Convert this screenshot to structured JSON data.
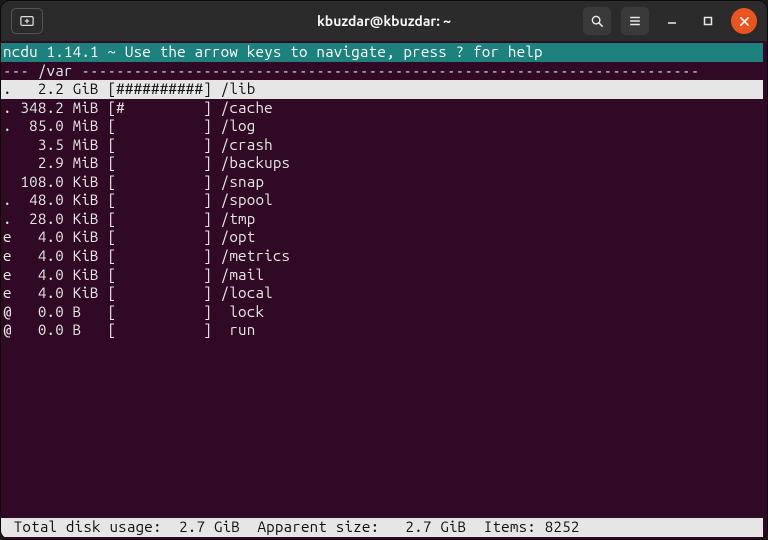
{
  "titlebar": {
    "title": "kbuzdar@kbuzdar: ~"
  },
  "header": "ncdu 1.14.1 ~ Use the arrow keys to navigate, press ? for help",
  "path_prefix": "--- ",
  "path": "/var",
  "bar_full": 10,
  "entries": [
    {
      "flag": ".",
      "size": "2.2",
      "unit": "GiB",
      "hashes": 10,
      "name": "/lib",
      "selected": true
    },
    {
      "flag": ".",
      "size": "348.2",
      "unit": "MiB",
      "hashes": 1,
      "name": "/cache",
      "selected": false
    },
    {
      "flag": ".",
      "size": "85.0",
      "unit": "MiB",
      "hashes": 0,
      "name": "/log",
      "selected": false
    },
    {
      "flag": " ",
      "size": "3.5",
      "unit": "MiB",
      "hashes": 0,
      "name": "/crash",
      "selected": false
    },
    {
      "flag": " ",
      "size": "2.9",
      "unit": "MiB",
      "hashes": 0,
      "name": "/backups",
      "selected": false
    },
    {
      "flag": " ",
      "size": "108.0",
      "unit": "KiB",
      "hashes": 0,
      "name": "/snap",
      "selected": false
    },
    {
      "flag": ".",
      "size": "48.0",
      "unit": "KiB",
      "hashes": 0,
      "name": "/spool",
      "selected": false
    },
    {
      "flag": ".",
      "size": "28.0",
      "unit": "KiB",
      "hashes": 0,
      "name": "/tmp",
      "selected": false
    },
    {
      "flag": "e",
      "size": "4.0",
      "unit": "KiB",
      "hashes": 0,
      "name": "/opt",
      "selected": false
    },
    {
      "flag": "e",
      "size": "4.0",
      "unit": "KiB",
      "hashes": 0,
      "name": "/metrics",
      "selected": false
    },
    {
      "flag": "e",
      "size": "4.0",
      "unit": "KiB",
      "hashes": 0,
      "name": "/mail",
      "selected": false
    },
    {
      "flag": "e",
      "size": "4.0",
      "unit": "KiB",
      "hashes": 0,
      "name": "/local",
      "selected": false
    },
    {
      "flag": "@",
      "size": "0.0",
      "unit": "B",
      "hashes": 0,
      "name": " lock",
      "selected": false
    },
    {
      "flag": "@",
      "size": "0.0",
      "unit": "B",
      "hashes": 0,
      "name": " run",
      "selected": false
    }
  ],
  "status": {
    "label_total": " Total disk usage:",
    "total": "2.7 GiB",
    "label_apparent": "Apparent size:",
    "apparent": "2.7 GiB",
    "label_items": "Items:",
    "items": "8252"
  }
}
